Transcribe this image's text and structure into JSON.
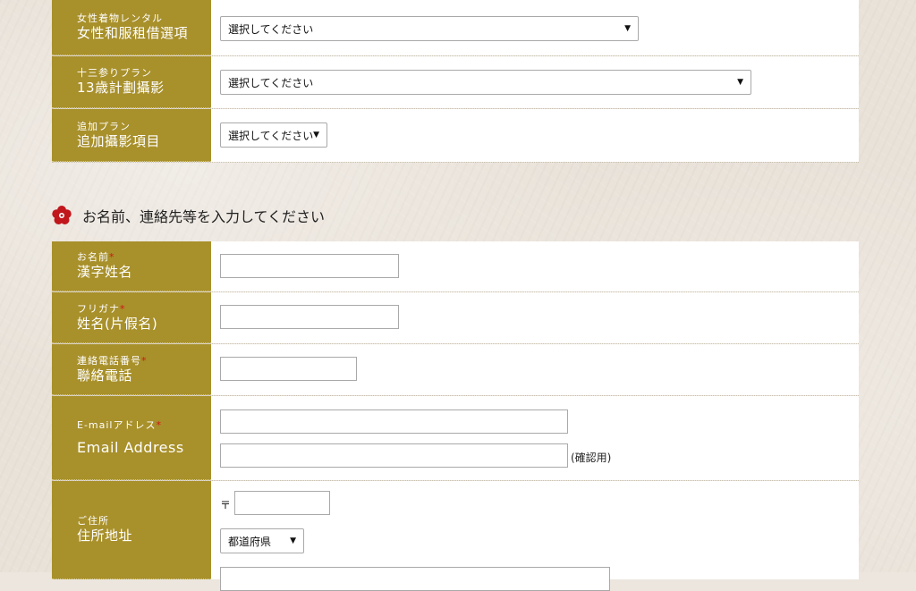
{
  "plan_section": {
    "rows": [
      {
        "label_small": "女性着物レンタル",
        "label_big": "女性和服租借選項",
        "select_value": "選択してください"
      },
      {
        "label_small": "十三参りプラン",
        "label_big": "13歳計劃攝影",
        "select_value": "選択してください"
      },
      {
        "label_small": "追加プラン",
        "label_big": "追加攝影項目",
        "select_value": "選択してください"
      }
    ]
  },
  "contact_section": {
    "heading": "お名前、連絡先等を入力してください",
    "required_mark": "*",
    "name": {
      "label_small": "お名前",
      "label_big": "漢字姓名",
      "value": ""
    },
    "furigana": {
      "label_small": "フリガナ",
      "label_big": "姓名(片假名)",
      "value": ""
    },
    "phone": {
      "label_small": "連絡電話番号",
      "label_big": "聯絡電話",
      "value": ""
    },
    "email": {
      "label_small": "E-mailアドレス",
      "label_big": "Email Address",
      "value": "",
      "confirm_value": "",
      "confirm_note": "(確認用)"
    },
    "address": {
      "label_small": "ご住所",
      "label_big": "住所地址",
      "postal_mark": "〒",
      "postal_value": "",
      "prefecture_value": "都道府県"
    }
  },
  "colors": {
    "label_bg": "#a8902b",
    "required": "#d01818",
    "accent_flower": "#c0161c"
  }
}
